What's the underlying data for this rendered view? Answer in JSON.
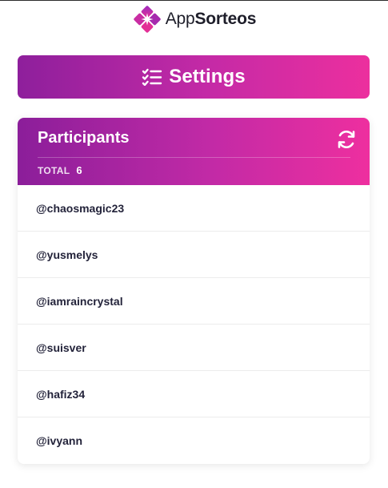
{
  "brand": {
    "name_regular": "App",
    "name_bold": "Sorteos",
    "logo_icon": "diamond-spark-icon"
  },
  "settings_button": {
    "label": "Settings",
    "icon": "checklist-icon"
  },
  "participants": {
    "title": "Participants",
    "refresh_icon": "refresh-icon",
    "total_label": "TOTAL",
    "total_value": "6",
    "items": [
      {
        "handle": "@chaosmagic23"
      },
      {
        "handle": "@yusmelys"
      },
      {
        "handle": "@iamraincrystal"
      },
      {
        "handle": "@suisver"
      },
      {
        "handle": "@hafiz34"
      },
      {
        "handle": "@ivyann"
      }
    ]
  },
  "colors": {
    "gradient_start": "#8e1f9c",
    "gradient_end": "#ec2f9e",
    "text_dark": "#23233a"
  }
}
